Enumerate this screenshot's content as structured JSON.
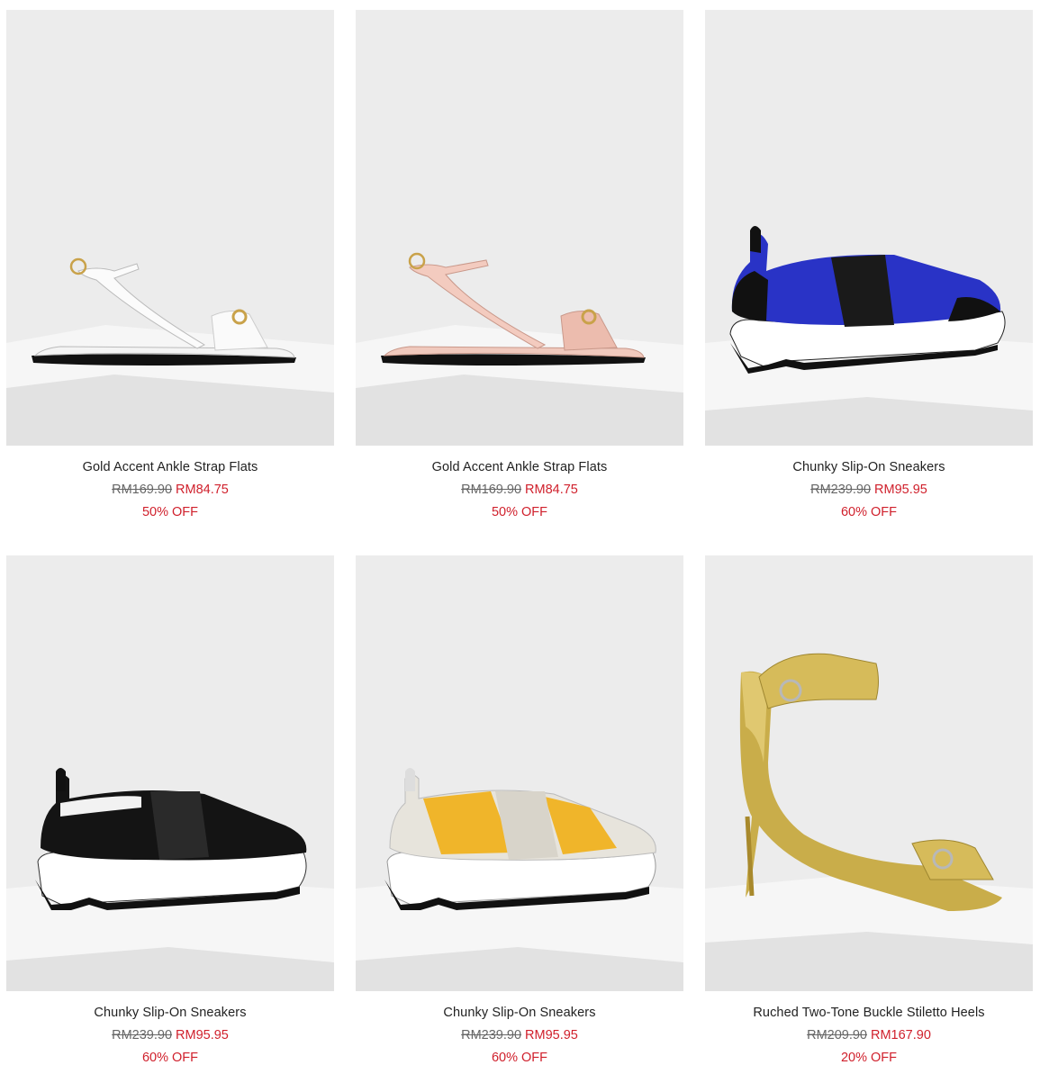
{
  "products": [
    {
      "name": "Gold Accent Ankle Strap Flats",
      "old_price": "RM169.90",
      "new_price": "RM84.75",
      "discount": "50% OFF",
      "image": "white-sandal"
    },
    {
      "name": "Gold Accent Ankle Strap Flats",
      "old_price": "RM169.90",
      "new_price": "RM84.75",
      "discount": "50% OFF",
      "image": "pink-sandal"
    },
    {
      "name": "Chunky Slip-On Sneakers",
      "old_price": "RM239.90",
      "new_price": "RM95.95",
      "discount": "60% OFF",
      "image": "blue-sneaker"
    },
    {
      "name": "Chunky Slip-On Sneakers",
      "old_price": "RM239.90",
      "new_price": "RM95.95",
      "discount": "60% OFF",
      "image": "black-sneaker"
    },
    {
      "name": "Chunky Slip-On Sneakers",
      "old_price": "RM239.90",
      "new_price": "RM95.95",
      "discount": "60% OFF",
      "image": "yellow-sneaker"
    },
    {
      "name": "Ruched Two-Tone Buckle Stiletto Heels",
      "old_price": "RM209.90",
      "new_price": "RM167.90",
      "discount": "20% OFF",
      "image": "gold-heel"
    }
  ],
  "colors": {
    "sale": "#d0202c",
    "photo_bg": "#ececec"
  }
}
